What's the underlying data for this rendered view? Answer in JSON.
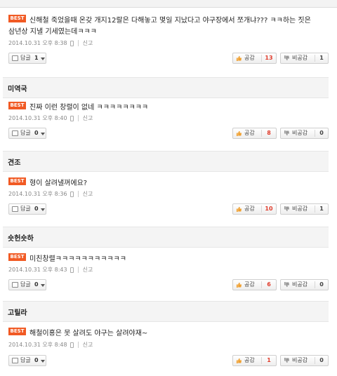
{
  "badge_label": "BEST",
  "reply_label": "답글",
  "like_label": "공감",
  "dislike_label": "비공감",
  "report_label": "신고",
  "colors": {
    "best_badge": "#f15a24",
    "like_count": "#e03c2c"
  },
  "comments": [
    {
      "author": "",
      "text_line1": "신해철 죽었을때 온갖 개지12랄은 다해놓고 몇일 지났다고 야구장에서 쪼개냐??? ㅋㅋ하는 짓은",
      "text_line2": "삼년상 지낼 기세였는데ㅋㅋㅋ",
      "date": "2014.10.31 오후 8:38",
      "reply_count": "1",
      "like_count": "13",
      "dislike_count": "1"
    },
    {
      "author": "미역국",
      "text_line1": "진짜 이런 창렬이 없네 ㅋㅋㅋㅋㅋㅋㅋㅋ",
      "date": "2014.10.31 오후 8:40",
      "reply_count": "0",
      "like_count": "8",
      "dislike_count": "0"
    },
    {
      "author": "견조",
      "text_line1": "형이 살려낼꺼에요?",
      "date": "2014.10.31 오후 8:36",
      "reply_count": "0",
      "like_count": "10",
      "dislike_count": "1"
    },
    {
      "author": "숏헌숏하",
      "text_line1": "미친창렬ㅋㅋㅋㅋㅋㅋㅋㅋㅋㅋㅋ",
      "date": "2014.10.31 오후 8:43",
      "reply_count": "0",
      "like_count": "6",
      "dislike_count": "0"
    },
    {
      "author": "고릴라",
      "text_line1": "해철이횽은 못 살려도 야구는 살려야재~",
      "date": "2014.10.31 오후 8:48",
      "reply_count": "0",
      "like_count": "1",
      "dislike_count": "0"
    }
  ]
}
